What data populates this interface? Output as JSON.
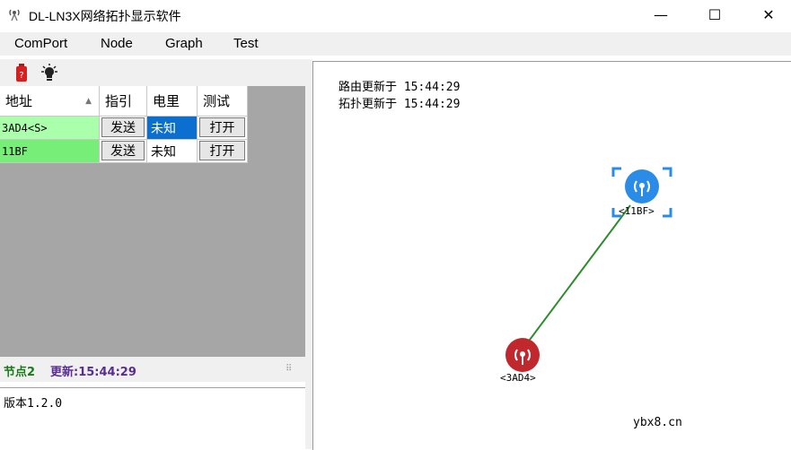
{
  "window": {
    "title": "DL-LN3X网络拓扑显示软件",
    "min_glyph": "—",
    "max_glyph": "☐",
    "close_glyph": "✕"
  },
  "menu": [
    "ComPort",
    "Node",
    "Graph",
    "Test"
  ],
  "toolbar": {
    "icons": [
      "battery-red-icon",
      "bulb-icon"
    ]
  },
  "grid": {
    "headers": [
      "地址",
      "指引",
      "电里",
      "测试"
    ],
    "rows": [
      {
        "addr": "3AD4<S>",
        "guide": "发送",
        "power": "未知",
        "test": "打开",
        "row_color": "#aaffaa",
        "power_selected": true
      },
      {
        "addr": "11BF",
        "guide": "发送",
        "power": "未知",
        "test": "打开",
        "row_color": "#77ee77",
        "power_selected": false
      }
    ]
  },
  "status": {
    "node_count": "节点2",
    "updated": "更新:15:44:29"
  },
  "version": "版本1.2.0",
  "topology": {
    "route_update": "路由更新于 15:44:29",
    "topo_update": "拓扑更新于 15:44:29",
    "nodes": [
      {
        "label": "<3AD4>",
        "color": "#c0282d"
      },
      {
        "label": "<11BF>",
        "color": "#2b8ce8"
      }
    ],
    "link_color": "#2e8b2e",
    "watermark": "ybx8.cn"
  },
  "colors": {
    "selected_blue": "#0b6fd0",
    "status_green": "#1a7a1a",
    "status_purple": "#5a2d91"
  }
}
